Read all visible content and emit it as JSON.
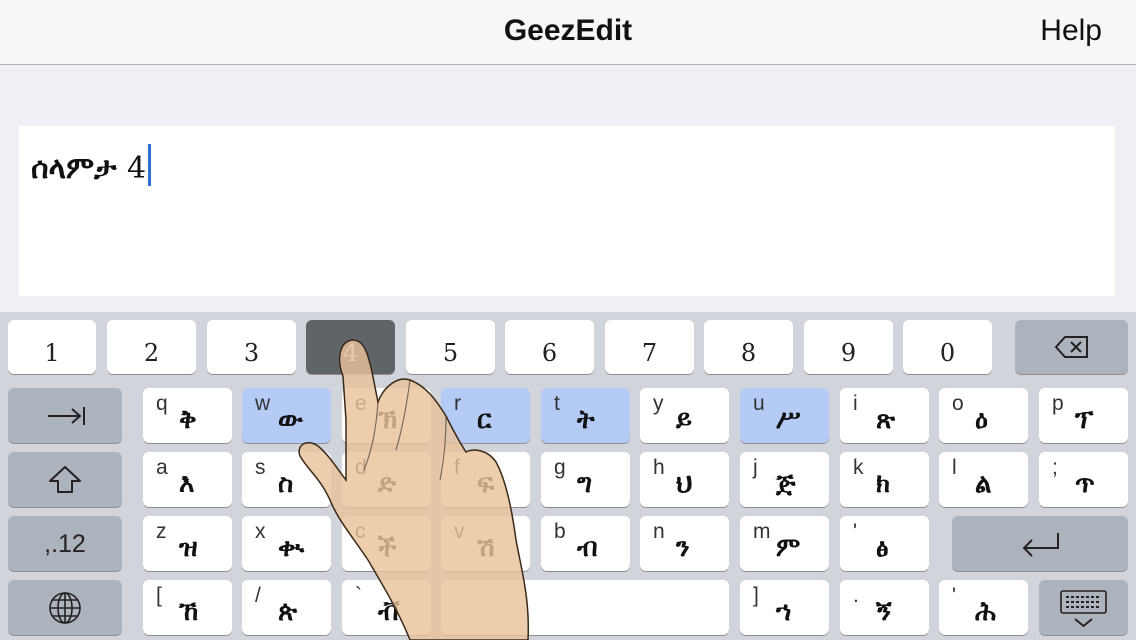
{
  "nav": {
    "title": "GeezEdit",
    "help": "Help"
  },
  "editor": {
    "text": "ሰላምታ",
    "digit": "4"
  },
  "keyboard": {
    "numbers": [
      "1",
      "2",
      "3",
      "4",
      "5",
      "6",
      "7",
      "8",
      "9",
      "0"
    ],
    "pressed_key": "4",
    "row1": [
      {
        "lat": "q",
        "eth": "ቅ"
      },
      {
        "lat": "w",
        "eth": "ው"
      },
      {
        "lat": "e",
        "eth": "ኽ"
      },
      {
        "lat": "r",
        "eth": "ር"
      },
      {
        "lat": "t",
        "eth": "ት"
      },
      {
        "lat": "y",
        "eth": "ይ"
      },
      {
        "lat": "u",
        "eth": "ሥ"
      },
      {
        "lat": "i",
        "eth": "ጽ"
      },
      {
        "lat": "o",
        "eth": "ዕ"
      },
      {
        "lat": "p",
        "eth": "ፕ"
      }
    ],
    "row2": [
      {
        "lat": "a",
        "eth": "እ"
      },
      {
        "lat": "s",
        "eth": "ስ"
      },
      {
        "lat": "d",
        "eth": "ድ"
      },
      {
        "lat": "f",
        "eth": "ፍ"
      },
      {
        "lat": "g",
        "eth": "ግ"
      },
      {
        "lat": "h",
        "eth": "ህ"
      },
      {
        "lat": "j",
        "eth": "ጅ"
      },
      {
        "lat": "k",
        "eth": "ክ"
      },
      {
        "lat": "l",
        "eth": "ል"
      },
      {
        "lat": ";",
        "eth": "ጥ"
      }
    ],
    "row3": [
      {
        "lat": "z",
        "eth": "ዝ"
      },
      {
        "lat": "x",
        "eth": "ቊ"
      },
      {
        "lat": "c",
        "eth": "ች"
      },
      {
        "lat": "v",
        "eth": "ሽ"
      },
      {
        "lat": "b",
        "eth": "ብ"
      },
      {
        "lat": "n",
        "eth": "ን"
      },
      {
        "lat": "m",
        "eth": "ም"
      },
      {
        "lat": "'",
        "eth": "ፅ"
      }
    ],
    "row4_left": [
      {
        "lat": "[",
        "eth": "ኸ"
      },
      {
        "lat": "/",
        "eth": "ጵ"
      },
      {
        "lat": "`",
        "eth": "ቭ"
      }
    ],
    "row4_right": [
      {
        "lat": "]",
        "eth": "ኀ"
      },
      {
        "lat": ".",
        "eth": "ኝ"
      },
      {
        "lat": "'",
        "eth": "ሕ"
      }
    ],
    "mode_label": ",.12",
    "icons": {
      "tab": "tab-arrow-icon",
      "shift": "shift-up-arrow-icon",
      "globe": "globe-icon",
      "delete": "backspace-icon",
      "return": "return-arrow-icon",
      "dismiss": "keyboard-dismiss-icon"
    }
  }
}
